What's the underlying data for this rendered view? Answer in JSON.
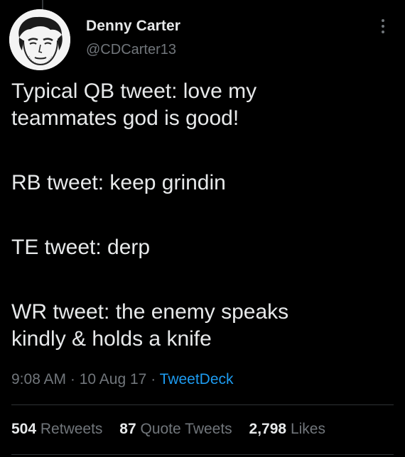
{
  "author": {
    "display_name": "Denny Carter",
    "handle": "@CDCarter13"
  },
  "tweet": {
    "lines": [
      "Typical QB tweet: love my",
      "teammates god is good!",
      "RB tweet: keep grindin",
      "TE tweet: derp",
      "WR tweet: the enemy speaks",
      "kindly & holds a knife"
    ],
    "time": "9:08 AM",
    "separator": "·",
    "date": "10 Aug 17",
    "source": "TweetDeck"
  },
  "stats": {
    "retweets_count": "504",
    "retweets_label": "Retweets",
    "quotes_count": "87",
    "quotes_label": "Quote Tweets",
    "likes_count": "2,798",
    "likes_label": "Likes"
  },
  "icons": {
    "more": "more-options-icon"
  },
  "colors": {
    "background": "#000000",
    "text_primary": "#e7e9ea",
    "text_secondary": "#71767b",
    "link": "#1d9bf0",
    "divider": "#2f3336"
  }
}
